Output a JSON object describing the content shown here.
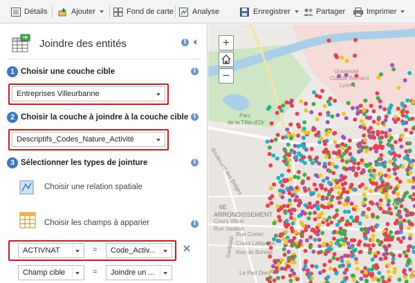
{
  "toolbar": {
    "details": "Détails",
    "add": "Ajouter",
    "basemap": "Fond de carte",
    "analysis": "Analyse",
    "save": "Enregistrer",
    "share": "Partager",
    "print": "Imprimer"
  },
  "panel": {
    "title": "Joindre des entités",
    "steps": [
      {
        "number": "1",
        "label": "Choisir une couche cible",
        "value": "Entreprises Villeurbanne"
      },
      {
        "number": "2",
        "label": "Choisir la couche à joindre à la couche cible",
        "value": "Descriptifs_Codes_Nature_Activité"
      },
      {
        "number": "3",
        "label": "Sélectionner les types de jointure"
      }
    ],
    "option_spatial": "Choisir une relation spatiale",
    "option_fields": "Choisir les champs à apparier",
    "field_rows": [
      {
        "target": "ACTIVNAT",
        "operator": "=",
        "join": "Code_Activ..."
      },
      {
        "target": "Champ cible",
        "operator": "=",
        "join": "Joindre un ..."
      }
    ]
  },
  "map": {
    "zoom_in": "+",
    "zoom_out": "−",
    "labels": {
      "univ1": "Université",
      "univ2": "Claude Bernard",
      "univ3": "Lyon 1",
      "parc1": "Parc",
      "parc2": "de la Tête-d'Or",
      "blvd": "Boulevard des Belges",
      "arr1": "6E",
      "arr2": "ARRONDISSEMENT",
      "s1": "Cours Vitton",
      "s2": "Rue Vauban",
      "s3": "Rue Cuvier",
      "s4": "Cours Lafayette",
      "s5": "Rue de Bonnel",
      "s6": "Le Part Dieu",
      "gar": "Garibaldi"
    }
  },
  "colors": {
    "accent": "#3b76c4",
    "highlight": "#e0161a",
    "map_points": [
      "#e8404c",
      "#f0c419",
      "#1fb3c8",
      "#3fae4a",
      "#e8404c",
      "#e8404c",
      "#9b59b6"
    ]
  }
}
